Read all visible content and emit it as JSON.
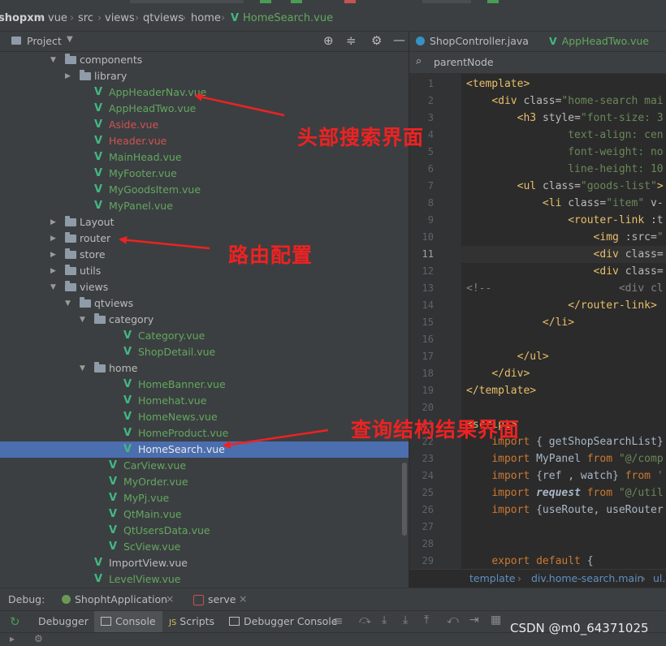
{
  "topbar": {
    "breadcrumbs": [
      "shopxm",
      "vue",
      "src",
      "views",
      "qtviews",
      "home",
      "HomeSearch.vue"
    ],
    "run_config": "ShoptApplication"
  },
  "project_panel": {
    "title": "Project",
    "tree": [
      {
        "label": "components",
        "type": "folder",
        "depth": 0,
        "expanded": true
      },
      {
        "label": "library",
        "type": "folder",
        "depth": 1,
        "expanded": false
      },
      {
        "label": "AppHeaderNav.vue",
        "type": "vue",
        "depth": 1,
        "color": "green"
      },
      {
        "label": "AppHeadTwo.vue",
        "type": "vue",
        "depth": 1,
        "color": "green"
      },
      {
        "label": "Aside.vue",
        "type": "vue",
        "depth": 1,
        "color": "red"
      },
      {
        "label": "Header.vue",
        "type": "vue",
        "depth": 1,
        "color": "red"
      },
      {
        "label": "MainHead.vue",
        "type": "vue",
        "depth": 1,
        "color": "green"
      },
      {
        "label": "MyFooter.vue",
        "type": "vue",
        "depth": 1,
        "color": "green"
      },
      {
        "label": "MyGoodsItem.vue",
        "type": "vue",
        "depth": 1,
        "color": "green"
      },
      {
        "label": "MyPanel.vue",
        "type": "vue",
        "depth": 1,
        "color": "green"
      },
      {
        "label": "Layout",
        "type": "folder",
        "depth": 0,
        "expanded": false
      },
      {
        "label": "router",
        "type": "folder",
        "depth": 0,
        "expanded": false
      },
      {
        "label": "store",
        "type": "folder",
        "depth": 0,
        "expanded": false
      },
      {
        "label": "utils",
        "type": "folder",
        "depth": 0,
        "expanded": false
      },
      {
        "label": "views",
        "type": "folder",
        "depth": 0,
        "expanded": true
      },
      {
        "label": "qtviews",
        "type": "folder",
        "depth": 1,
        "expanded": true
      },
      {
        "label": "category",
        "type": "folder",
        "depth": 2,
        "expanded": true
      },
      {
        "label": "Category.vue",
        "type": "vue",
        "depth": 3,
        "color": "green"
      },
      {
        "label": "ShopDetail.vue",
        "type": "vue",
        "depth": 3,
        "color": "green"
      },
      {
        "label": "home",
        "type": "folder",
        "depth": 2,
        "expanded": true
      },
      {
        "label": "HomeBanner.vue",
        "type": "vue",
        "depth": 3,
        "color": "green"
      },
      {
        "label": "Homehat.vue",
        "type": "vue",
        "depth": 3,
        "color": "green"
      },
      {
        "label": "HomeNews.vue",
        "type": "vue",
        "depth": 3,
        "color": "green"
      },
      {
        "label": "HomeProduct.vue",
        "type": "vue",
        "depth": 3,
        "color": "green"
      },
      {
        "label": "HomeSearch.vue",
        "type": "vue",
        "depth": 3,
        "color": "plain",
        "selected": true
      },
      {
        "label": "CarView.vue",
        "type": "vue",
        "depth": 2,
        "color": "green"
      },
      {
        "label": "MyOrder.vue",
        "type": "vue",
        "depth": 2,
        "color": "green"
      },
      {
        "label": "MyPj.vue",
        "type": "vue",
        "depth": 2,
        "color": "green"
      },
      {
        "label": "QtMain.vue",
        "type": "vue",
        "depth": 2,
        "color": "green"
      },
      {
        "label": "QtUsersData.vue",
        "type": "vue",
        "depth": 2,
        "color": "green"
      },
      {
        "label": "ScView.vue",
        "type": "vue",
        "depth": 2,
        "color": "green"
      },
      {
        "label": "ImportView.vue",
        "type": "vue",
        "depth": 1,
        "color": "plain"
      },
      {
        "label": "LevelView.vue",
        "type": "vue",
        "depth": 1,
        "color": "green"
      }
    ]
  },
  "editor": {
    "tabs": [
      "ShopController.java",
      "AppHeadTwo.vue"
    ],
    "search_value": "parentNode",
    "current_line": 11,
    "lines": [
      {
        "n": 1,
        "html": "<span class='t-tag'>&lt;template&gt;</span>"
      },
      {
        "n": 2,
        "html": "    <span class='t-tag'>&lt;div</span> <span class='t-attr'>class=</span><span class='t-str'>\"home-search mai</span>"
      },
      {
        "n": 3,
        "html": "        <span class='t-tag'>&lt;h3</span> <span class='t-attr'>style=</span><span class='t-str'>\"font-size: 3</span>"
      },
      {
        "n": 4,
        "html": "                <span class='t-str'>text-align: cen</span>"
      },
      {
        "n": 5,
        "html": "                <span class='t-str'>font-weight: no</span>"
      },
      {
        "n": 6,
        "html": "                <span class='t-str'>line-height: 10</span>"
      },
      {
        "n": 7,
        "html": "        <span class='t-tag'>&lt;ul</span> <span class='t-attr'>class=</span><span class='t-str'>\"goods-list\"</span><span class='t-tag'>&gt;</span>"
      },
      {
        "n": 8,
        "html": "            <span class='t-tag'>&lt;li</span> <span class='t-attr'>class=</span><span class='t-str'>\"item\"</span> <span class='t-attr'>v-</span>"
      },
      {
        "n": 9,
        "html": "                <span class='t-tag'>&lt;router-link</span> <span class='t-attr'>:t</span>"
      },
      {
        "n": 10,
        "html": "                    <span class='t-tag'>&lt;img</span> <span class='t-attr'>:src=</span><span class='t-str'>\"</span>"
      },
      {
        "n": 11,
        "html": "                    <span class='t-tag'>&lt;div</span> <span class='t-attr'>class=</span>"
      },
      {
        "n": 12,
        "html": "                    <span class='t-tag'>&lt;div</span> <span class='t-attr'>class=</span>"
      },
      {
        "n": 13,
        "html": "<span class='t-com'>&lt;!--                    &lt;div cl</span>"
      },
      {
        "n": 14,
        "html": "                <span class='t-tag'>&lt;/router-link&gt;</span>"
      },
      {
        "n": 15,
        "html": "            <span class='t-tag'>&lt;/li&gt;</span>"
      },
      {
        "n": 16,
        "html": ""
      },
      {
        "n": 17,
        "html": "        <span class='t-tag'>&lt;/ul&gt;</span>"
      },
      {
        "n": 18,
        "html": "    <span class='t-tag'>&lt;/div&gt;</span>"
      },
      {
        "n": 19,
        "html": "<span class='t-tag'>&lt;/template&gt;</span>"
      },
      {
        "n": 20,
        "html": ""
      },
      {
        "n": 21,
        "html": "<span class='t-tag'>&lt;script</span><span class='t-tag'>&gt;</span>"
      },
      {
        "n": 22,
        "html": "    <span class='t-kw'>import</span> { getShopSearchList}"
      },
      {
        "n": 23,
        "html": "    <span class='t-kw'>import</span> MyPanel <span class='t-kw'>from</span> <span class='t-str'>\"@/comp</span>"
      },
      {
        "n": 24,
        "html": "    <span class='t-kw'>import</span> {ref , watch} <span class='t-kw'>from</span> <span class='t-str'>'</span>"
      },
      {
        "n": 25,
        "html": "    <span class='t-kw'>import</span> <span class='t-it'>request</span> <span class='t-kw'>from</span> <span class='t-str'>\"@/util</span>"
      },
      {
        "n": 26,
        "html": "    <span class='t-kw'>import</span> {useRoute, useRouter"
      },
      {
        "n": 27,
        "html": ""
      },
      {
        "n": 28,
        "html": ""
      },
      {
        "n": 29,
        "html": "    <span class='t-kw'>export default</span> {"
      }
    ],
    "breadcrumb": [
      "template",
      "div.home-search.main",
      "ul.g"
    ]
  },
  "debug": {
    "label": "Debug:",
    "sessions": [
      "ShophtApplication",
      "serve"
    ],
    "tabs": [
      "Debugger",
      "Console",
      "Scripts",
      "Debugger Console"
    ],
    "active_tab": "Console"
  },
  "annotations": {
    "header_search": "头部搜索界面",
    "router_config": "路由配置",
    "query_result": "查询结构结果界面"
  },
  "watermark": "CSDN @m0_64371025"
}
